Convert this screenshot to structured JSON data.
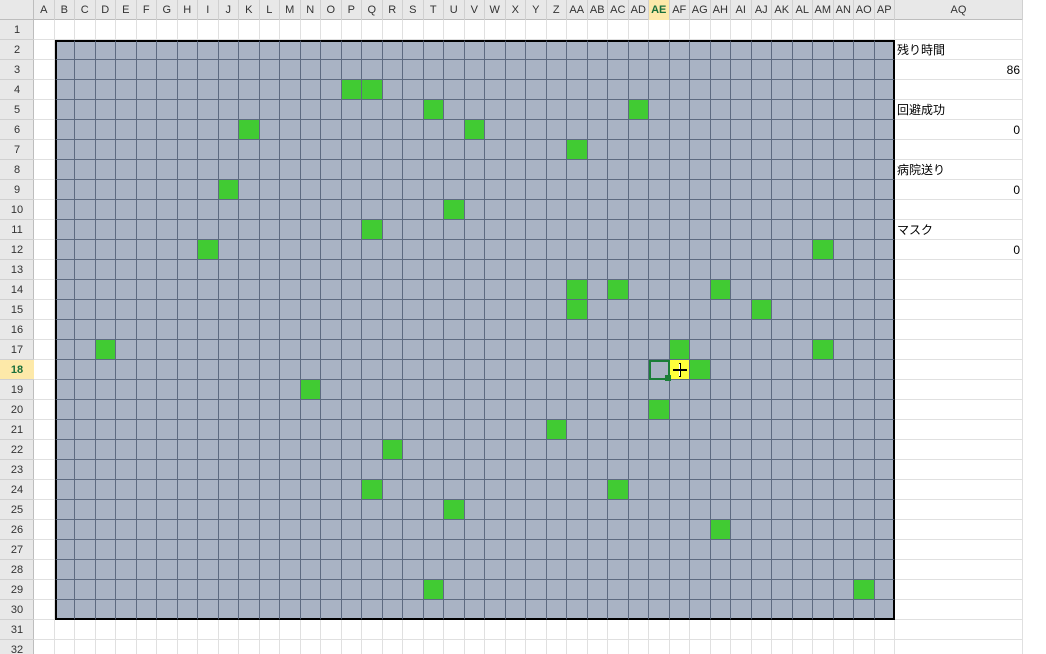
{
  "column_headers": [
    "A",
    "B",
    "C",
    "D",
    "E",
    "F",
    "G",
    "H",
    "I",
    "J",
    "K",
    "L",
    "M",
    "N",
    "O",
    "P",
    "Q",
    "R",
    "S",
    "T",
    "U",
    "V",
    "W",
    "X",
    "Y",
    "Z",
    "AA",
    "AB",
    "AC",
    "AD",
    "AE",
    "AF",
    "AG",
    "AH",
    "AI",
    "AJ",
    "AK",
    "AL",
    "AM",
    "AN",
    "AO",
    "AP",
    "AQ"
  ],
  "board_cell_w": 20.5,
  "stats_col_w": 128,
  "selected_col_index": 30,
  "selected_row_index": 17,
  "board": {
    "col_start": 1,
    "col_end": 41,
    "row_start": 1,
    "row_end": 29
  },
  "green_cells": [
    {
      "r": 3,
      "c": 15
    },
    {
      "r": 3,
      "c": 16
    },
    {
      "r": 4,
      "c": 19
    },
    {
      "r": 4,
      "c": 29
    },
    {
      "r": 5,
      "c": 10
    },
    {
      "r": 5,
      "c": 21
    },
    {
      "r": 6,
      "c": 26
    },
    {
      "r": 8,
      "c": 9
    },
    {
      "r": 9,
      "c": 20
    },
    {
      "r": 10,
      "c": 16
    },
    {
      "r": 11,
      "c": 8
    },
    {
      "r": 11,
      "c": 38
    },
    {
      "r": 13,
      "c": 26
    },
    {
      "r": 13,
      "c": 28
    },
    {
      "r": 13,
      "c": 33
    },
    {
      "r": 14,
      "c": 26
    },
    {
      "r": 14,
      "c": 35
    },
    {
      "r": 16,
      "c": 3
    },
    {
      "r": 16,
      "c": 31
    },
    {
      "r": 16,
      "c": 38
    },
    {
      "r": 17,
      "c": 32
    },
    {
      "r": 18,
      "c": 13
    },
    {
      "r": 19,
      "c": 30
    },
    {
      "r": 20,
      "c": 25
    },
    {
      "r": 21,
      "c": 17
    },
    {
      "r": 23,
      "c": 16
    },
    {
      "r": 23,
      "c": 28
    },
    {
      "r": 24,
      "c": 20
    },
    {
      "r": 25,
      "c": 33
    },
    {
      "r": 28,
      "c": 19
    },
    {
      "r": 28,
      "c": 40
    }
  ],
  "yellow_cell": {
    "r": 17,
    "c": 31
  },
  "stats": {
    "time_label": "残り時間",
    "time_value": "86",
    "evade_label": "回避成功",
    "evade_value": "0",
    "hospital_label": "病院送り",
    "hospital_value": "0",
    "mask_label": "マスク",
    "mask_value": "0"
  },
  "stat_rows": {
    "time_label_row": 1,
    "time_value_row": 2,
    "evade_label_row": 4,
    "evade_value_row": 5,
    "hospital_label_row": 7,
    "hospital_value_row": 8,
    "mask_label_row": 10,
    "mask_value_row": 11
  },
  "visible_rows": 32
}
